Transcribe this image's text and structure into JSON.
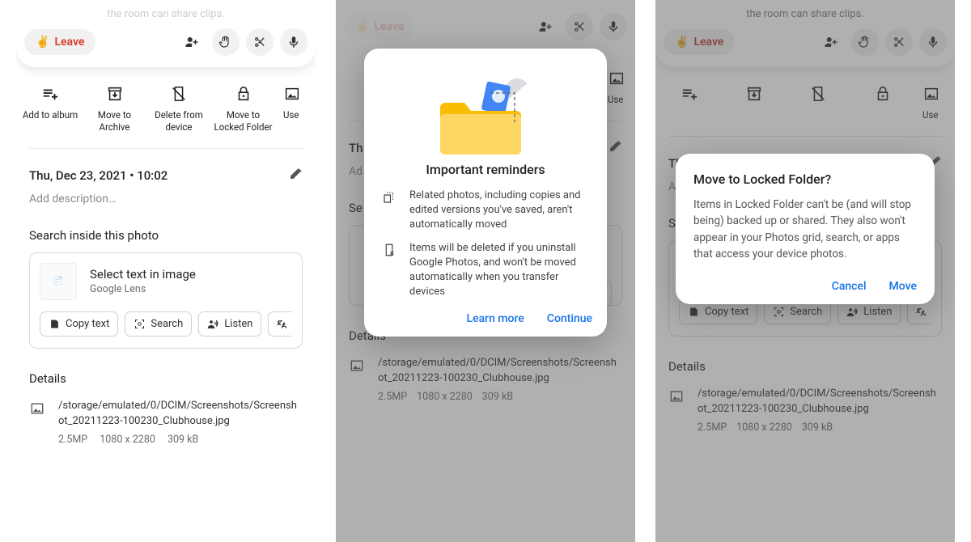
{
  "clubhouse": {
    "clip_text_full": "the room can share clips.",
    "leave_label": "Leave",
    "peace_emoji": "✌️"
  },
  "actions": {
    "add_to_album": "Add to album",
    "move_to_archive": "Move to Archive",
    "delete_from_device": "Delete from device",
    "move_to_locked": "Move to Locked Folder",
    "use_as_cut": "Use"
  },
  "info": {
    "datetime": "Thu, Dec 23, 2021 • 10:02",
    "desc_placeholder": "Add description…",
    "search_inside": "Search inside this photo"
  },
  "lens": {
    "title": "Select text in image",
    "subtitle": "Google Lens",
    "copy": "Copy text",
    "search": "Search",
    "listen": "Listen",
    "translate_cut": "T"
  },
  "details": {
    "label": "Details",
    "path": "/storage/emulated/0/DCIM/Screenshots/Screenshot_20211223-100230_Clubhouse.jpg",
    "mp": "2.5MP",
    "res": "1080 x 2280",
    "size": "309 kB"
  },
  "screen2_info": {
    "th_short": "Th",
    "ad_short": "Ad",
    "se_short": "Se",
    "t_short": "T"
  },
  "reminders_modal": {
    "title": "Important reminders",
    "r1": "Related photos, including copies and edited versions you've saved, aren't automatically moved",
    "r2": "Items will be deleted if you uninstall Google Photos, and won't be moved automatically when you transfer devices",
    "learn_more": "Learn more",
    "continue": "Continue"
  },
  "locked_modal": {
    "title": "Move to Locked Folder?",
    "body": "Items in Locked Folder can't be (and will stop being) backed up or shared. They also won't appear in your Photos grid, search, or apps that access your device photos.",
    "cancel": "Cancel",
    "move": "Move"
  }
}
